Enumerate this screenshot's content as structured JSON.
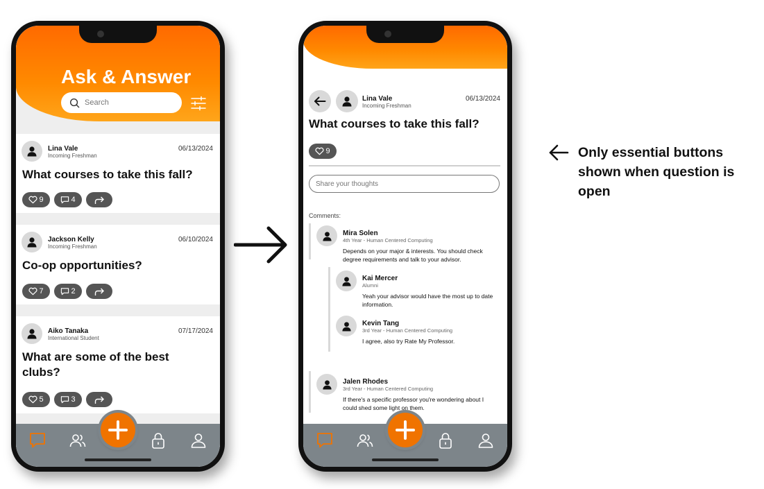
{
  "feed": {
    "title": "Ask & Answer",
    "search_placeholder": "Search",
    "posts": [
      {
        "author": "Lina Vale",
        "role": "Incoming Freshman",
        "date": "06/13/2024",
        "question": "What courses to take this fall?",
        "likes": "9",
        "comments": "4"
      },
      {
        "author": "Jackson Kelly",
        "role": "Incoming Freshman",
        "date": "06/10/2024",
        "question": "Co-op opportunities?",
        "likes": "7",
        "comments": "2"
      },
      {
        "author": "Aiko Tanaka",
        "role": "International Student",
        "date": "07/17/2024",
        "question": "What are some of the best clubs?",
        "likes": "5",
        "comments": "3"
      }
    ]
  },
  "detail": {
    "author": "Lina Vale",
    "role": "Incoming Freshman",
    "date": "06/13/2024",
    "question": "What courses to take this fall?",
    "likes": "9",
    "reply_placeholder": "Share your thoughts",
    "comments_label": "Comments:",
    "comments": [
      {
        "author": "Mira Solen",
        "role": "4th Year - Human Centered Computing",
        "text": "Depends on your major & interests. You should check degree requirements and talk to your advisor."
      },
      {
        "author": "Kai Mercer",
        "role": "Alumni",
        "text": "Yeah your advisor would have the most up to date information."
      },
      {
        "author": "Kevin Tang",
        "role": "3rd Year - Human Centered Computing",
        "text": "I agree, also try Rate My Professor."
      },
      {
        "author": "Jalen Rhodes",
        "role": "3rd Year - Human Centered Computing",
        "text": "If there's a specific professor you're wondering about I could shed some light on them."
      }
    ]
  },
  "annotation": {
    "text": "Only essential buttons shown when question is open"
  },
  "colors": {
    "brand_orange": "#f07300",
    "tabbar_gray": "#7d858a",
    "pill_gray": "#555555"
  },
  "icons": [
    "search-icon",
    "filter-icon",
    "heart-icon",
    "comment-icon",
    "share-icon",
    "chat-icon",
    "people-icon",
    "plus-icon",
    "lock-icon",
    "profile-icon",
    "back-arrow-icon",
    "avatar-icon"
  ]
}
